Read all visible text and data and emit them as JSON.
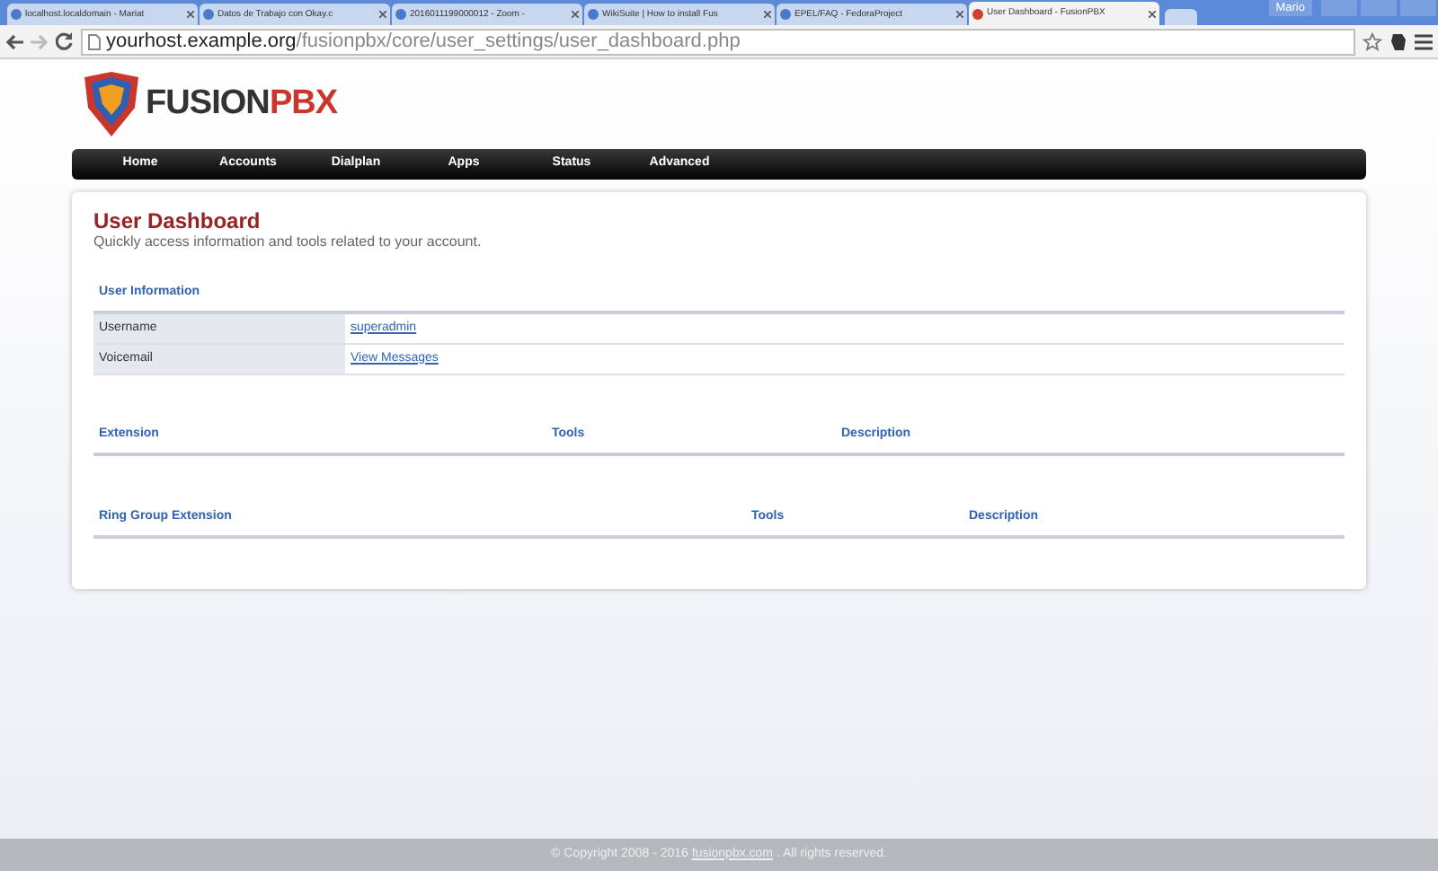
{
  "browser": {
    "tabs": [
      {
        "title": "localhost.localdomain - Mariat",
        "selected": false
      },
      {
        "title": "Datos de Trabajo con Okay.c",
        "selected": false
      },
      {
        "title": "2016011199000012 - Zoom -",
        "selected": false
      },
      {
        "title": "WikiSuite | How to install Fus",
        "selected": false
      },
      {
        "title": "EPEL/FAQ - FedoraProject",
        "selected": false
      },
      {
        "title": "User Dashboard - FusionPBX",
        "selected": true
      }
    ],
    "user": "Mario",
    "address": {
      "host": "yourhost.example.org",
      "path": "/fusionpbx/core/user_settings/user_dashboard.php"
    }
  },
  "logo": {
    "first": "FUSION",
    "second": "PBX"
  },
  "nav": [
    "Home",
    "Accounts",
    "Dialplan",
    "Apps",
    "Status",
    "Advanced"
  ],
  "page": {
    "title": "User Dashboard",
    "subtitle": "Quickly access information and tools related to your account.",
    "user_info": {
      "heading": "User Information",
      "rows": [
        {
          "label": "Username",
          "value": "superadmin"
        },
        {
          "label": "Voicemail",
          "value": "View Messages"
        }
      ]
    },
    "tables": [
      {
        "columns": [
          "Extension",
          "Tools",
          "Description"
        ]
      },
      {
        "columns": [
          "Ring Group Extension",
          "Tools",
          "Description"
        ]
      }
    ]
  },
  "footer": {
    "before": "© Copyright 2008 - 2016 ",
    "link": "fusionpbx.com",
    "after": " . All rights reserved."
  }
}
